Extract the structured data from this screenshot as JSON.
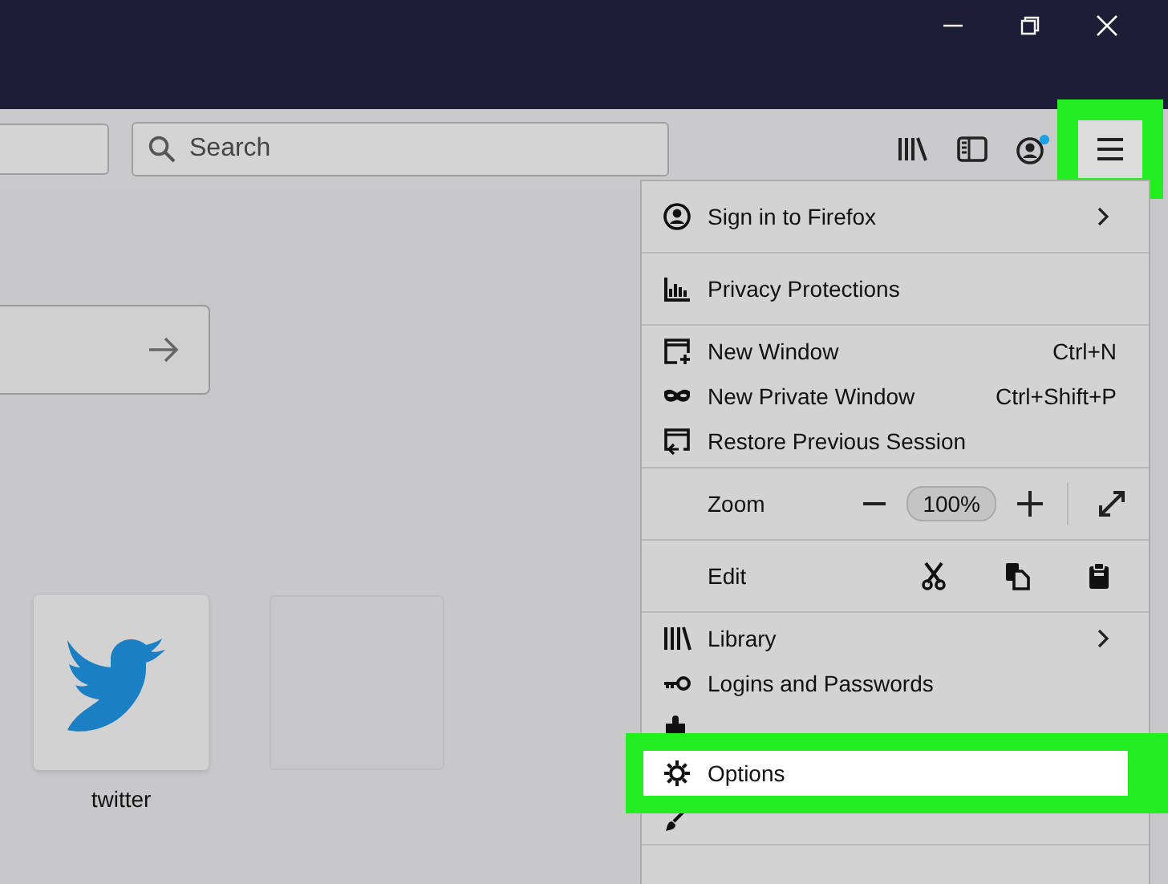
{
  "toolbar": {
    "search": {
      "placeholder": "Search"
    },
    "account_badge": true,
    "menu_button": {
      "highlighted": true
    }
  },
  "content": {
    "tiles": [
      {
        "kind": "twitter",
        "label": "twitter"
      },
      {
        "kind": "empty"
      }
    ]
  },
  "menu": {
    "sections": [
      [
        {
          "kind": "account",
          "label": "Sign in to Firefox",
          "submenu": true,
          "selected": false
        }
      ],
      [
        {
          "kind": "privacy",
          "label": "Privacy Protections",
          "submenu": false,
          "selected": false
        }
      ],
      [
        {
          "kind": "new-window",
          "label": "New Window",
          "shortcut": "Ctrl+N",
          "submenu": false,
          "selected": false
        },
        {
          "kind": "private-window",
          "label": "New Private Window",
          "shortcut": "Ctrl+Shift+P",
          "submenu": false,
          "selected": false
        },
        {
          "kind": "restore",
          "label": "Restore Previous Session",
          "submenu": false,
          "selected": false
        }
      ],
      [
        {
          "kind": "zoom",
          "label": "Zoom",
          "value": "100%"
        }
      ],
      [
        {
          "kind": "edit",
          "label": "Edit"
        }
      ],
      [
        {
          "kind": "library",
          "label": "Library",
          "submenu": true,
          "selected": false
        },
        {
          "kind": "logins",
          "label": "Logins and Passwords",
          "submenu": false,
          "selected": false
        },
        {
          "kind": "addons",
          "selected": false
        },
        {
          "kind": "options",
          "label": "Options",
          "submenu": false,
          "selected": true
        },
        {
          "kind": "customize",
          "selected": false
        }
      ]
    ]
  }
}
